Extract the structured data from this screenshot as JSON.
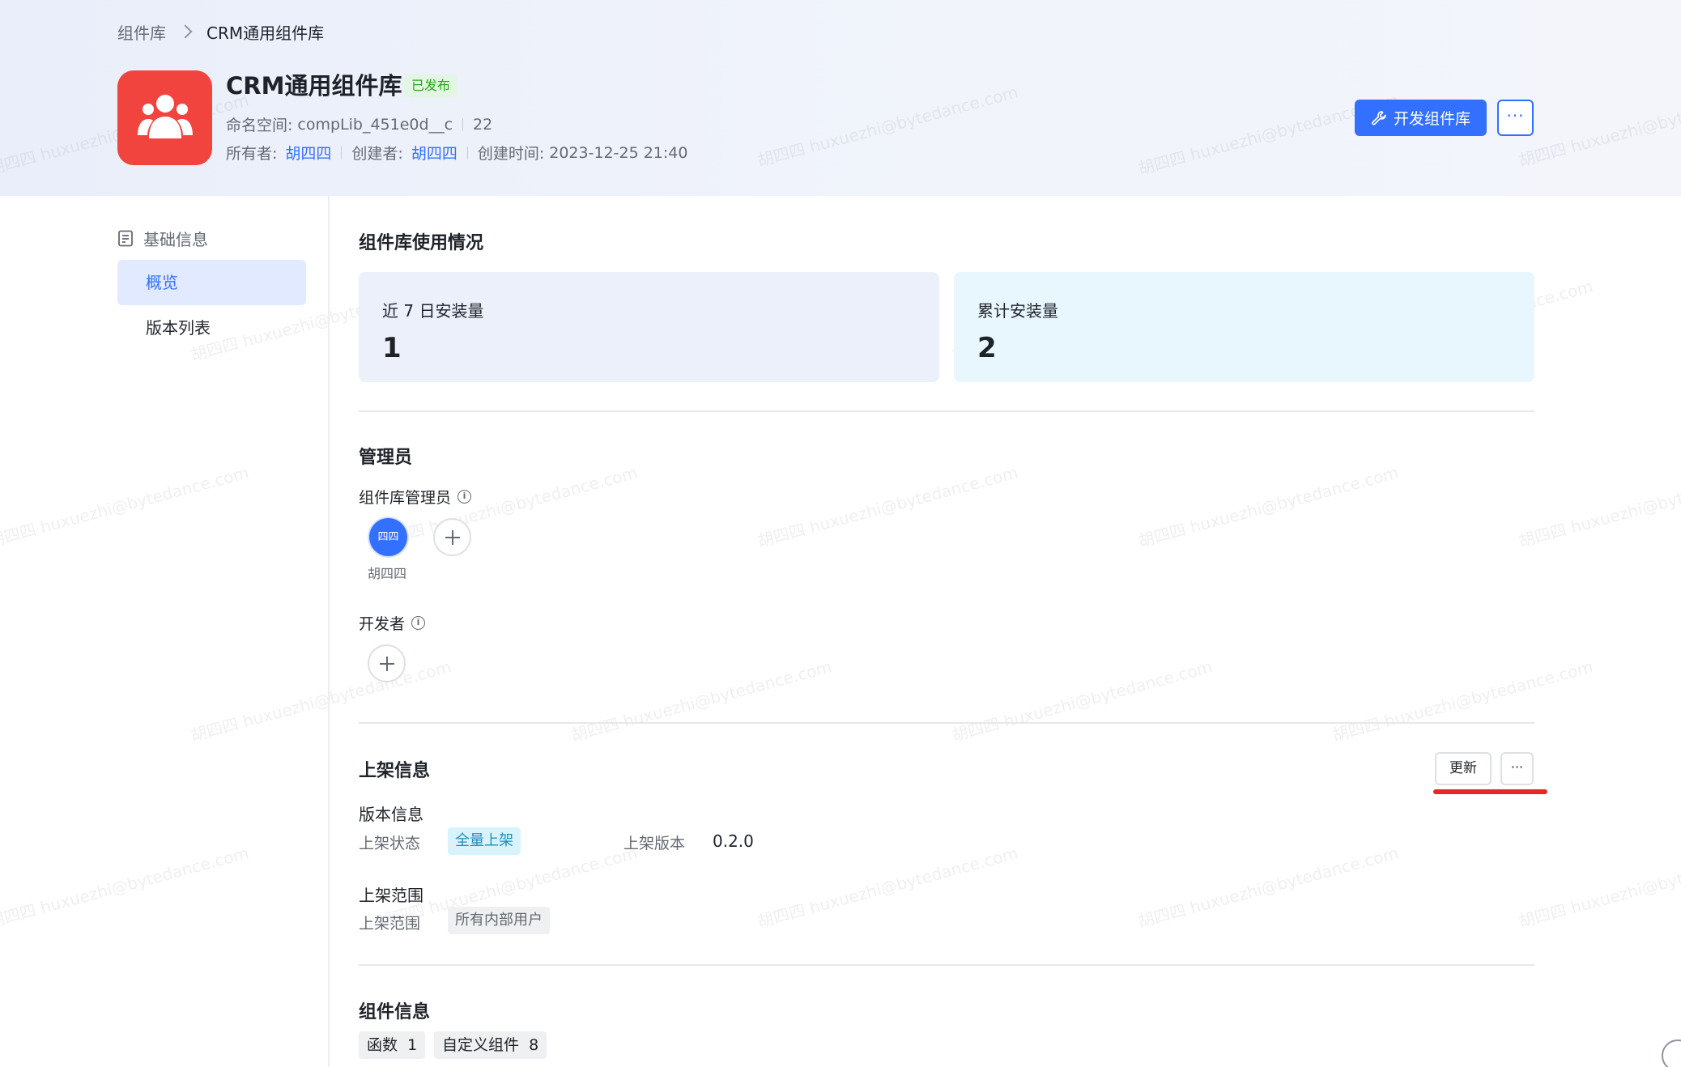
{
  "breadcrumb": {
    "root": "组件库",
    "current": "CRM通用组件库"
  },
  "library": {
    "title": "CRM通用组件库",
    "status": "已发布",
    "namespace_label": "命名空间:",
    "namespace": "compLib_451e0d__c",
    "count": "22",
    "owner_label": "所有者:",
    "owner": "胡四四",
    "creator_label": "创建者:",
    "creator": "胡四四",
    "created_label": "创建时间:",
    "created_at": "2023-12-25 21:40",
    "logo_color": "#f1443f"
  },
  "actions": {
    "develop": "开发组件库",
    "more": "···"
  },
  "sidebar": {
    "group_label": "基础信息",
    "items": [
      {
        "label": "概览",
        "active": true
      },
      {
        "label": "版本列表",
        "active": false
      }
    ]
  },
  "usage": {
    "title": "组件库使用情况",
    "recent_label": "近 7 日安装量",
    "recent_value": "1",
    "total_label": "累计安装量",
    "total_value": "2"
  },
  "admins": {
    "title": "管理员",
    "lib_admin_label": "组件库管理员",
    "admin_avatar": "四四",
    "admin_name": "胡四四",
    "developer_label": "开发者"
  },
  "listing": {
    "title": "上架信息",
    "update_button": "更新",
    "more_button": "···",
    "version_section": "版本信息",
    "status_label": "上架状态",
    "status_value": "全量上架",
    "version_label": "上架版本",
    "version_value": "0.2.0",
    "scope_section": "上架范围",
    "scope_label": "上架范围",
    "scope_value": "所有内部用户"
  },
  "components": {
    "title": "组件信息",
    "tags": [
      "函数  1",
      "自定义组件  8"
    ]
  },
  "colors": {
    "accent": "#3370ff",
    "highlight": "#e8272b",
    "success": "#2ea121"
  }
}
